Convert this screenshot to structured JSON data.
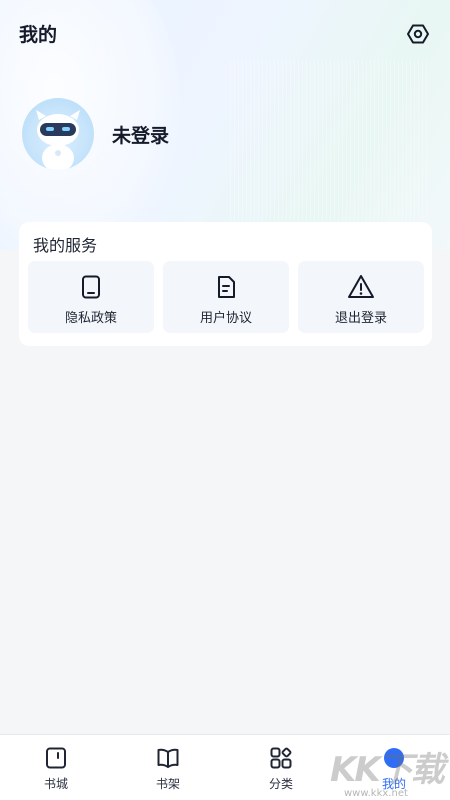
{
  "header": {
    "title": "我的",
    "settings_icon": "settings-hex-icon"
  },
  "profile": {
    "status": "未登录",
    "avatar_icon": "robot-avatar"
  },
  "services": {
    "title": "我的服务",
    "items": [
      {
        "label": "隐私政策",
        "icon": "phone-icon"
      },
      {
        "label": "用户协议",
        "icon": "document-icon"
      },
      {
        "label": "退出登录",
        "icon": "warning-icon"
      }
    ]
  },
  "tabbar": {
    "items": [
      {
        "label": "书城",
        "icon": "bookstore-icon"
      },
      {
        "label": "书架",
        "icon": "bookshelf-icon"
      },
      {
        "label": "分类",
        "icon": "category-icon"
      },
      {
        "label": "我的",
        "icon": "profile-icon",
        "active": true
      }
    ]
  },
  "watermark": {
    "text": "KK下载",
    "url": "www.kkx.net"
  },
  "colors": {
    "accent": "#2f6df5",
    "text_dark": "#151b2b",
    "card_bg": "#ffffff",
    "item_bg": "#f3f6fb"
  }
}
